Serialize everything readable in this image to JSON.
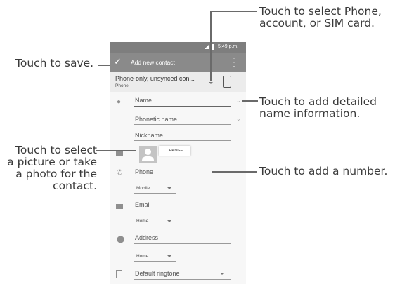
{
  "callouts": {
    "select_phone_line1": "Touch to select Phone,",
    "select_phone_line2": "account, or SIM card.",
    "save": "Touch to save.",
    "detailed_name_line1": "Touch to add detailed",
    "detailed_name_line2": "name information.",
    "picture_line1": "Touch to select",
    "picture_line2": "a picture or take",
    "picture_line3": "a photo for the",
    "picture_line4": "contact.",
    "add_number": "Touch to add a number."
  },
  "status_bar": {
    "time": "5:49 p.m."
  },
  "toolbar": {
    "title": "Add new contact",
    "check_icon": "check-icon",
    "overflow_icon": "more-vert-icon"
  },
  "account": {
    "name": "Phone-only, unsynced con...",
    "type": "Phone",
    "device_icon": "phone-device-icon"
  },
  "form": {
    "name_placeholder": "Name",
    "phonetic_placeholder": "Phonetic name",
    "nickname_placeholder": "Nickname",
    "photo_button": "CHANGE",
    "phone_placeholder": "Phone",
    "phone_type": "Mobile",
    "email_placeholder": "Email",
    "email_type": "Home",
    "address_placeholder": "Address",
    "address_type": "Home",
    "ringtone": "Default ringtone"
  }
}
